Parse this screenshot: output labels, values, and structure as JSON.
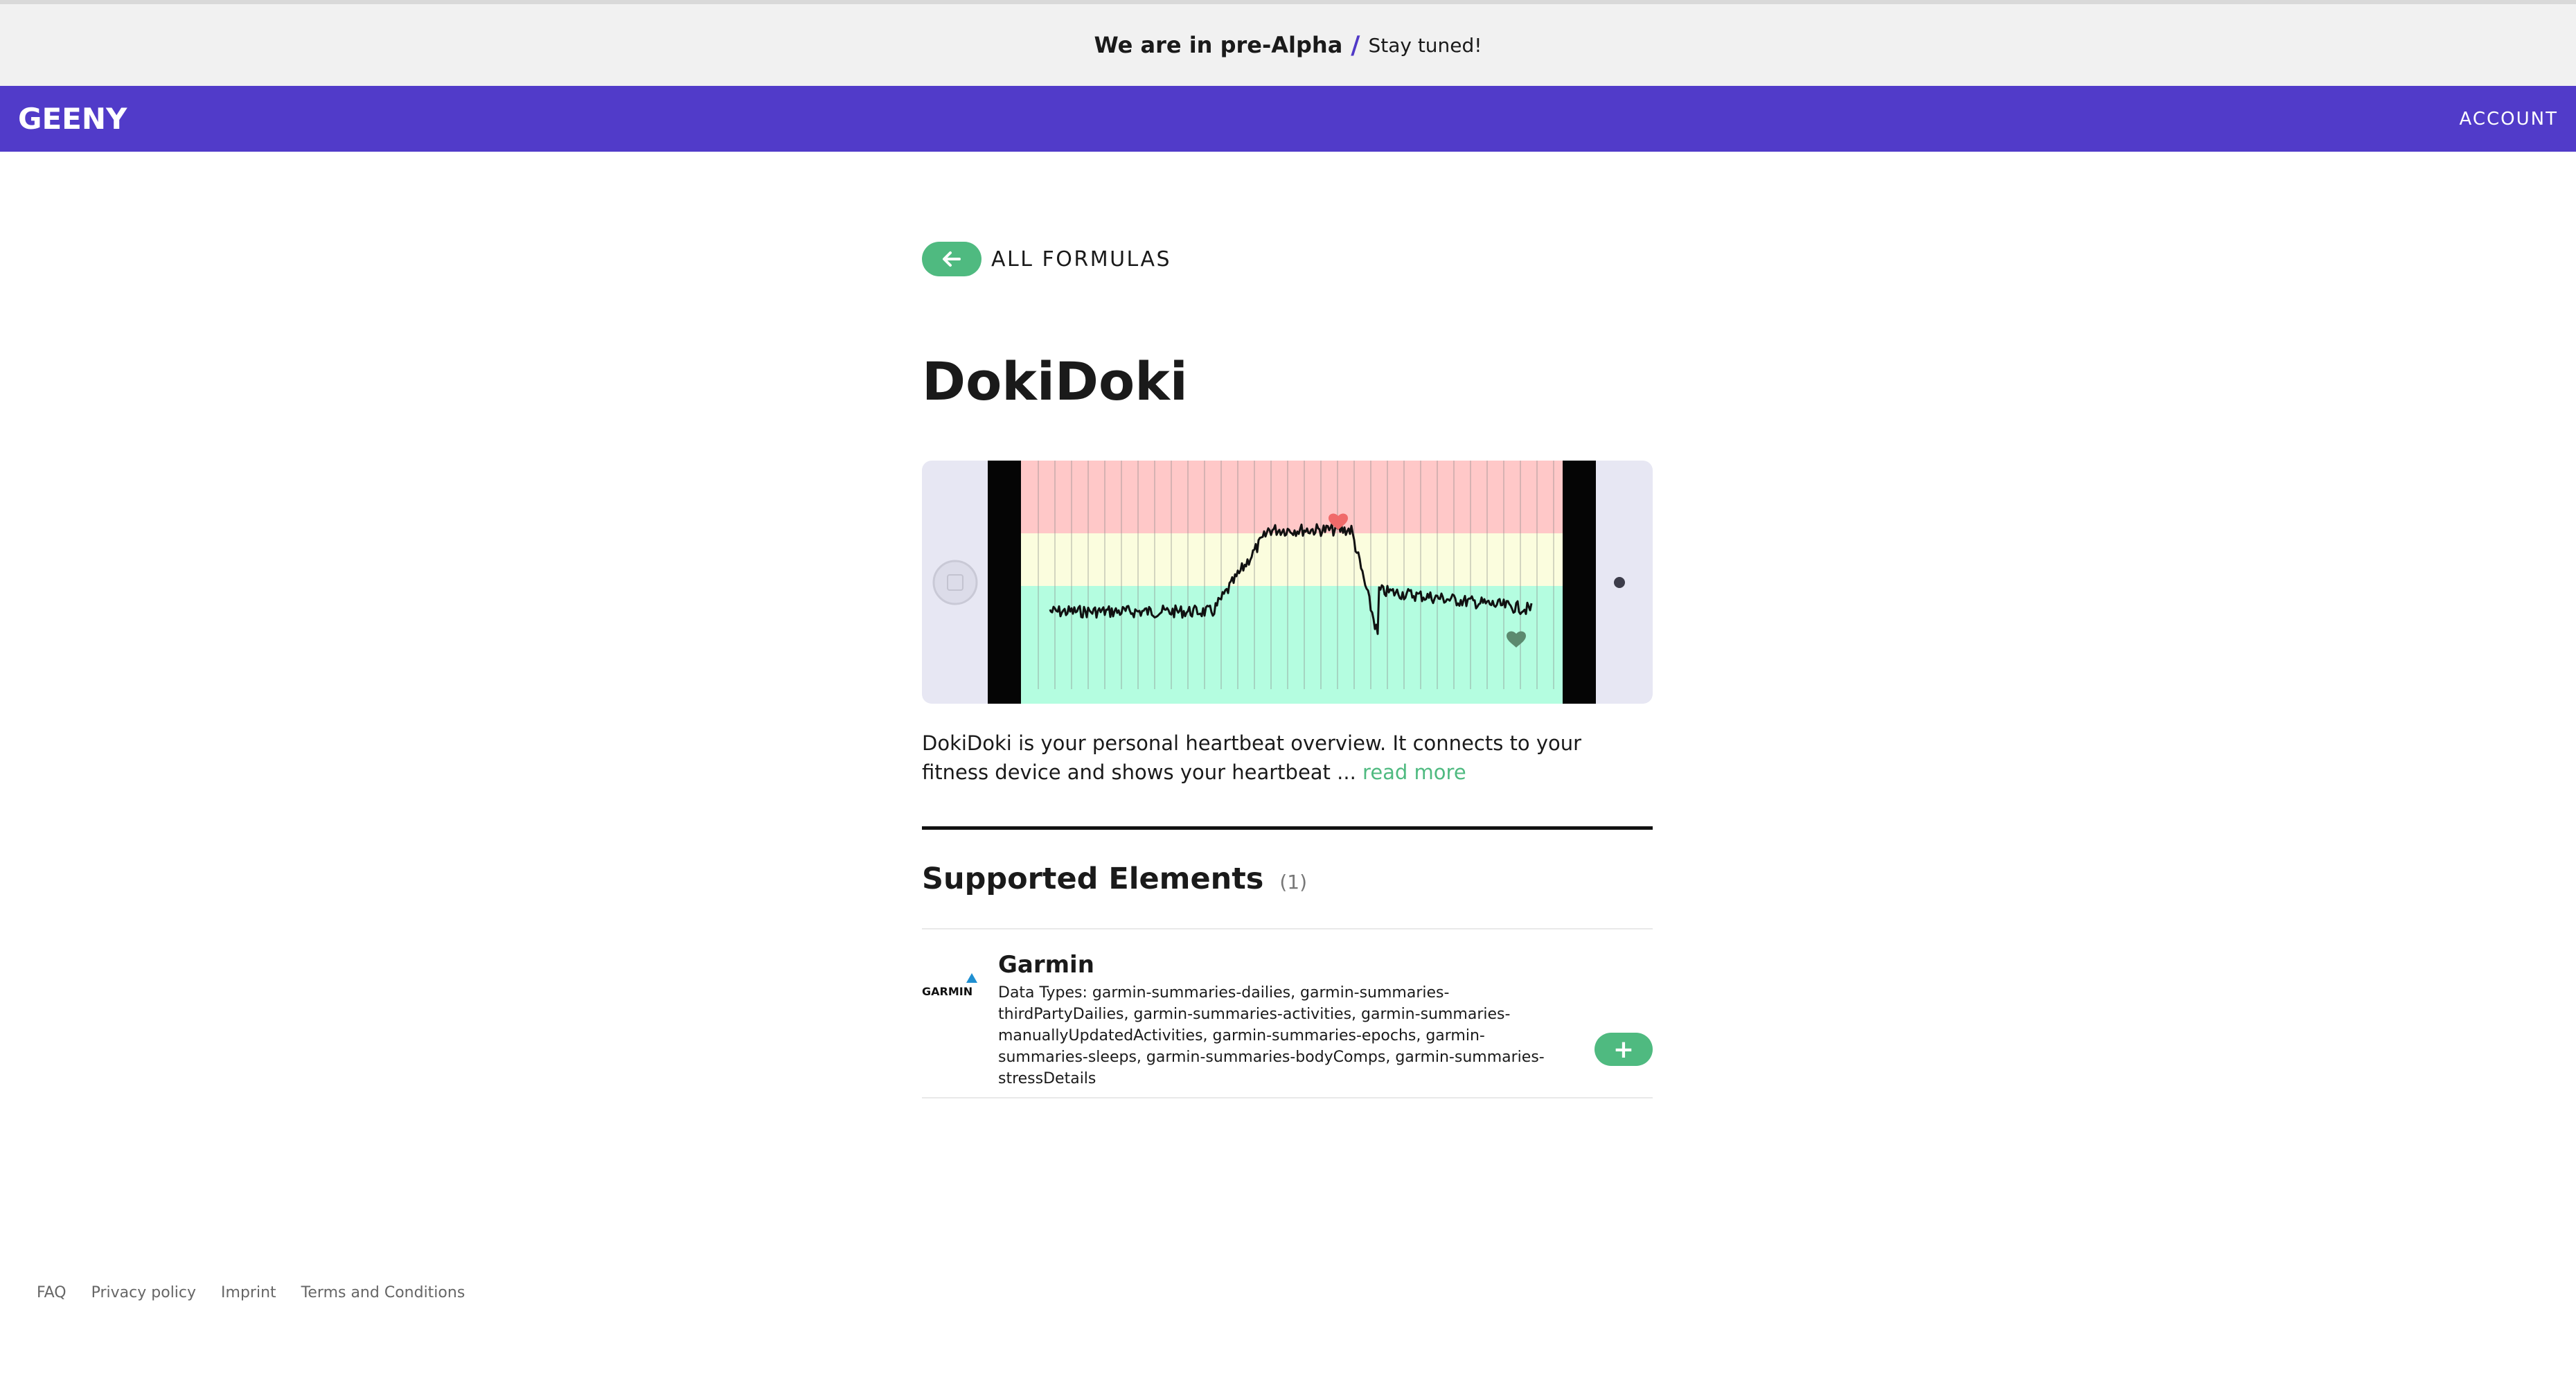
{
  "banner": {
    "strong": "We are in pre-Alpha",
    "separator": "/",
    "light": "Stay tuned!"
  },
  "navbar": {
    "logo_text": "GEENY",
    "account_label": "ACCOUNT",
    "accent": "#513bc9"
  },
  "back": {
    "label": "ALL FORMULAS",
    "icon": "arrow-left-icon"
  },
  "formula": {
    "title": "DokiDoki",
    "description": "DokiDoki is your personal heartbeat overview. It connects to your fitness device and shows your heartbeat",
    "ellipsis": "...",
    "read_more": "read more"
  },
  "supported": {
    "title": "Supported Elements",
    "count": "(1)",
    "elements": [
      {
        "name": "Garmin",
        "logo_text": "GARMIN",
        "data_types": "Data Types: garmin-summaries-dailies, garmin-summaries-thirdPartyDailies, garmin-summaries-activities, garmin-summaries-manuallyUpdatedActivities, garmin-summaries-epochs, garmin-summaries-sleeps, garmin-summaries-bodyComps, garmin-summaries-stressDetails",
        "add_label": "+"
      }
    ]
  },
  "footer": {
    "links": [
      "FAQ",
      "Privacy policy",
      "Imprint",
      "Terms and Conditions"
    ]
  },
  "colors": {
    "green": "#4fba80",
    "purple": "#513bc9",
    "zone_high": "#ffc8c8",
    "zone_mid": "#fbfdde",
    "zone_low": "#b4fde0"
  }
}
